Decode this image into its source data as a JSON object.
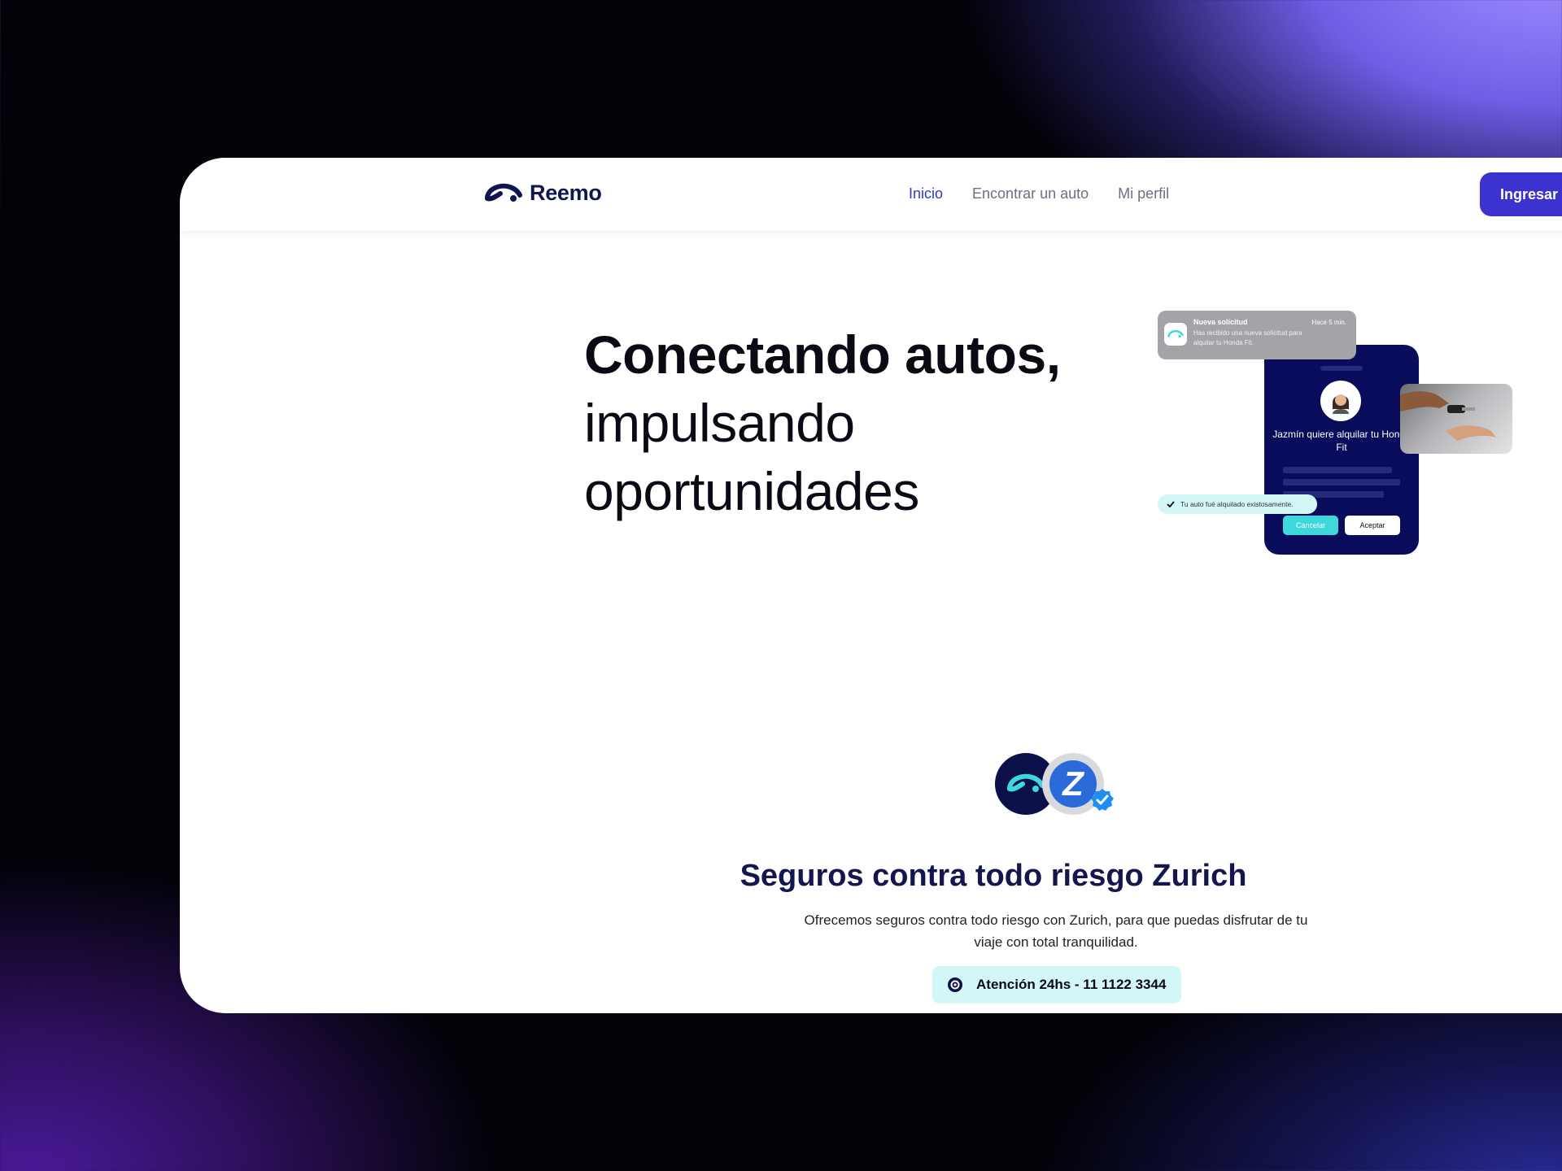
{
  "brand": {
    "name": "Reemo"
  },
  "nav": {
    "links": [
      {
        "label": "Inicio"
      },
      {
        "label": "Encontrar un auto"
      },
      {
        "label": "Mi perfil"
      }
    ],
    "cta_label": "Ingresar a"
  },
  "hero": {
    "line1": "Conectando autos,",
    "line2": "impulsando",
    "line3": "oportunidades"
  },
  "illustration": {
    "notification": {
      "title": "Nueva solicitud",
      "time": "Hace 5 min.",
      "body": "Has recibido una nueva solicitud para alquilar tu Honda Fit."
    },
    "phone": {
      "message": "Jazmín quiere alquilar tu Honda Fit",
      "cancel_label": "Cancelar",
      "accept_label": "Aceptar"
    },
    "toast": "Tu auto fué alquilado existosamente."
  },
  "insurance": {
    "title": "Seguros contra todo riesgo Zurich",
    "description": "Ofrecemos seguros contra todo riesgo con Zurich, para que puedas disfrutar de tu viaje con total tranquilidad.",
    "partner_letter": "Z",
    "contact": "Atención 24hs - 11 1122 3344"
  },
  "colors": {
    "primary": "#3c32cf",
    "navy": "#0b0f4a",
    "accent_cyan": "#3ed8dc",
    "light_cyan": "#d3f7f7"
  }
}
